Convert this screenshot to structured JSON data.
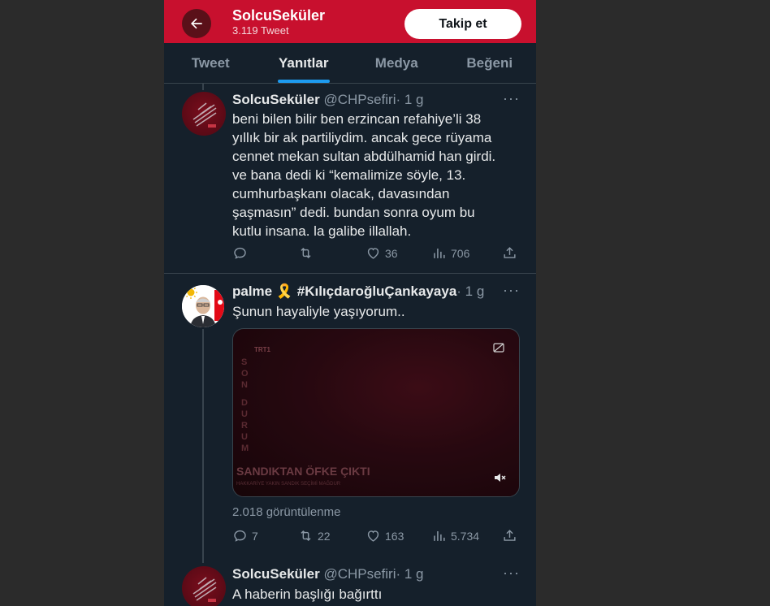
{
  "header": {
    "name": "SolcuSeküler",
    "tweet_count": "3.119 Tweet",
    "follow_label": "Takip et"
  },
  "tabs": [
    {
      "label": "Tweet",
      "active": false
    },
    {
      "label": "Yanıtlar",
      "active": true
    },
    {
      "label": "Medya",
      "active": false
    },
    {
      "label": "Beğeni",
      "active": false
    }
  ],
  "tweets": [
    {
      "name": "SolcuSeküler",
      "handle": "@CHPsefiri",
      "time": "· 1 g",
      "lines": [
        "beni bilen bilir ben erzincan refahiye’li 38",
        "yıllık bir ak partiliydim. ancak gece rüyama",
        "cennet mekan sultan abdülhamid han girdi.",
        "ve bana dedi ki “kemalimize söyle, 13.",
        "cumhurbaşkanı olacak, davasından",
        "şaşmasın” dedi. bundan sonra oyum bu",
        "kutlu insana. la galibe illallah."
      ],
      "replies": "",
      "retweets": "",
      "likes": "36",
      "views": "706"
    },
    {
      "name": "palme 🎗️ #KılıçdaroğluÇankayaya",
      "handle": "",
      "time": "· 1 g",
      "text": "Şunun hayaliyle yaşıyorum..",
      "video": {
        "channel": "TRT1",
        "vertical_text": "SON DURUM",
        "caption": "SANDIKTAN ÖFKE ÇIKTI",
        "subcaption": "HAKKARİYE YAKIN SANDIK SEÇİMİ MAĞDUR"
      },
      "view_count": "2.018 görüntülenme",
      "replies": "7",
      "retweets": "22",
      "likes": "163",
      "views": "5.734"
    },
    {
      "name": "SolcuSeküler",
      "handle": "@CHPsefiri",
      "time": "· 1 g",
      "text": "A haberin başlığı bağırttı"
    }
  ],
  "colors": {
    "header_bg": "#c8102e",
    "page_bg": "#15202b",
    "accent": "#1d9bf0",
    "text_primary": "#e7e9ea",
    "text_secondary": "#8b98a5"
  }
}
